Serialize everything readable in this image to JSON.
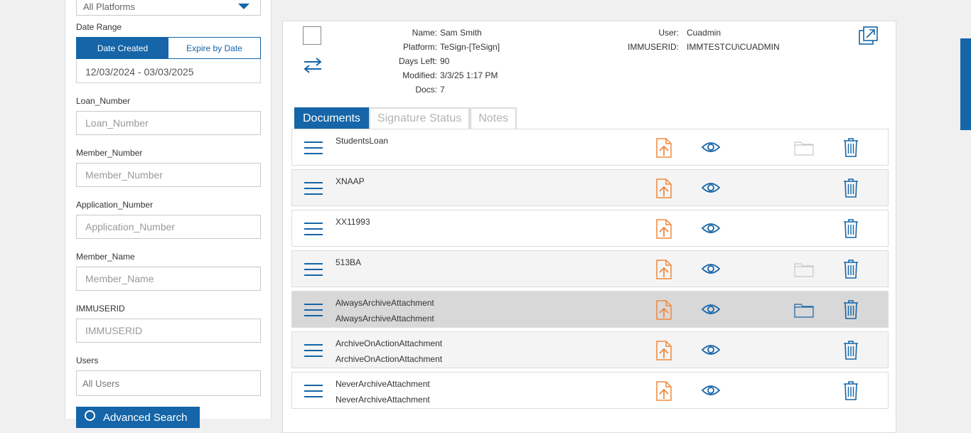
{
  "filters": {
    "platform_value": "All Platforms",
    "date_range_label": "Date Range",
    "date_created_label": "Date Created",
    "expire_by_date_label": "Expire by Date",
    "date_range_value": "12/03/2024 - 03/03/2025",
    "loan_number_label": "Loan_Number",
    "loan_number_placeholder": "Loan_Number",
    "member_number_label": "Member_Number",
    "member_number_placeholder": "Member_Number",
    "application_number_label": "Application_Number",
    "application_number_placeholder": "Application_Number",
    "member_name_label": "Member_Name",
    "member_name_placeholder": "Member_Name",
    "immuserid_label": "IMMUSERID",
    "immuserid_placeholder": "IMMUSERID",
    "users_label": "Users",
    "users_value": "All Users",
    "advanced_search_label": "Advanced Search"
  },
  "detail": {
    "name_key": "Name:",
    "name_value": "Sam Smith",
    "platform_key": "Platform:",
    "platform_value": "TeSign-[TeSign]",
    "days_left_key": "Days Left:",
    "days_left_value": "90",
    "modified_key": "Modified:",
    "modified_value": "3/3/25 1:17 PM",
    "docs_key": "Docs:",
    "docs_value": "7",
    "user_key": "User:",
    "user_value": "Cuadmin",
    "immuserid_key": "IMMUSERID:",
    "immuserid_value": "IMMTESTCU\\CUADMIN"
  },
  "tabs": [
    "Documents",
    "Signature Status",
    "Notes"
  ],
  "colors": {
    "accent": "#1565a8",
    "upload_icon": "#f0883a",
    "folder_icon_light": "#c8c8c8",
    "folder_icon_active": "#1565a8"
  },
  "documents": [
    {
      "title": "StudentsLoan",
      "subtitle": "",
      "folder": "light"
    },
    {
      "title": "XNAAP",
      "subtitle": "",
      "folder": "none"
    },
    {
      "title": "XX11993",
      "subtitle": "",
      "folder": "none"
    },
    {
      "title": "513BA",
      "subtitle": "",
      "folder": "light"
    },
    {
      "title": "AlwaysArchiveAttachment",
      "subtitle": "AlwaysArchiveAttachment",
      "folder": "active"
    },
    {
      "title": "ArchiveOnActionAttachment",
      "subtitle": "ArchiveOnActionAttachment",
      "folder": "none"
    },
    {
      "title": "NeverArchiveAttachment",
      "subtitle": "NeverArchiveAttachment",
      "folder": "none"
    }
  ]
}
